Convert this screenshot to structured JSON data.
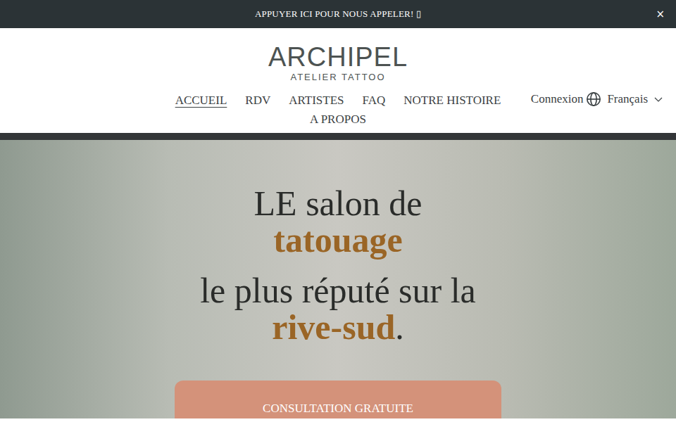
{
  "banner": {
    "text": "APPUYER ICI POUR NOUS APPELER! ▯",
    "close": "×"
  },
  "logo": {
    "title": "ARCHIPEL",
    "subtitle": "ATELIER TATTOO"
  },
  "nav": [
    {
      "label": "ACCUEIL",
      "selected": true
    },
    {
      "label": "RDV",
      "selected": false
    },
    {
      "label": "ARTISTES",
      "selected": false
    },
    {
      "label": "FAQ",
      "selected": false
    },
    {
      "label": "NOTRE HISTOIRE",
      "selected": false
    },
    {
      "label": "A PROPOS",
      "selected": false
    }
  ],
  "account": {
    "login": "Connexion",
    "language": "Français"
  },
  "hero": {
    "lines": [
      [
        {
          "text": "LE salon de",
          "accent": false
        }
      ],
      [
        {
          "text": "tatouage",
          "accent": true
        }
      ],
      [
        {
          "text": "le plus réputé sur la",
          "accent": false
        }
      ],
      [
        {
          "text": "rive-sud",
          "accent": true
        },
        {
          "text": ".",
          "accent": false
        }
      ]
    ],
    "button": "CONSULTATION GRATUITE"
  }
}
